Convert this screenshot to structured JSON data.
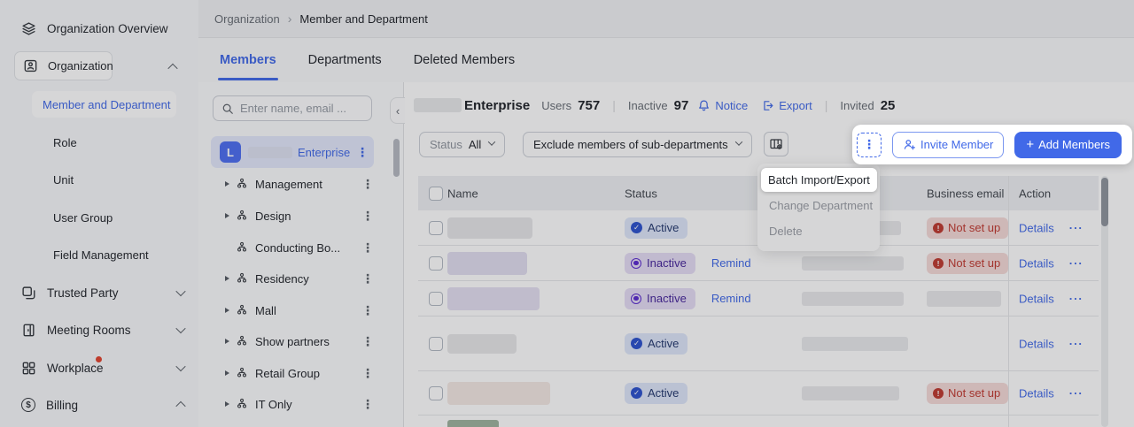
{
  "colors": {
    "accent": "#4169e8",
    "active_bg": "#dee7fa",
    "active_icon": "#2d52cf",
    "inactive_bg": "#e6ddf6",
    "inactive_icon": "#5b2bd0",
    "notset_bg": "#f6dbd8",
    "notset_fg": "#c13a31"
  },
  "icons": {
    "kebab": "⋮",
    "ellipsis": "···",
    "collapse": "‹",
    "crumb_sep": "›",
    "check": "✓",
    "exclaim": "!",
    "plus": "+",
    "dollar": "$"
  },
  "sidebar": {
    "items": [
      {
        "label": "Organization Overview"
      },
      {
        "label": "Organization"
      },
      {
        "label": "Member and Department"
      },
      {
        "label": "Role"
      },
      {
        "label": "Unit"
      },
      {
        "label": "User Group"
      },
      {
        "label": "Field Management"
      },
      {
        "label": "Trusted Party"
      },
      {
        "label": "Meeting Rooms"
      },
      {
        "label": "Workplace"
      },
      {
        "label": "Billing"
      }
    ]
  },
  "breadcrumb": {
    "parent": "Organization",
    "current": "Member and Department"
  },
  "tabs": [
    "Members",
    "Departments",
    "Deleted Members"
  ],
  "tree": {
    "search_placeholder": "Enter name, email ...",
    "root_letter": "L",
    "root_name": "Enterprise",
    "items": [
      "Management",
      "Design",
      "Conducting Bo...",
      "Residency",
      "Mall",
      "Show partners",
      "Retail Group",
      "IT Only"
    ]
  },
  "header": {
    "title": "Enterprise",
    "users_label": "Users",
    "users_value": "757",
    "divider": "|",
    "inactive_label": "Inactive",
    "inactive_value": "97",
    "notice_label": "Notice",
    "export_label": "Export",
    "invited_label": "Invited",
    "invited_value": "25"
  },
  "toolbar": {
    "status_label": "Status",
    "status_value": "All",
    "scope_value": "Exclude members of sub-departments",
    "invite_label": "Invite Member",
    "add_label": "Add Members"
  },
  "menu": {
    "items": [
      {
        "label": "Batch Import/Export"
      },
      {
        "label": "Change Department"
      },
      {
        "label": "Delete"
      }
    ]
  },
  "table": {
    "headers": [
      "Name",
      "Status",
      "",
      "Business email",
      "Action"
    ],
    "remind_label": "Remind",
    "not_set_label": "Not set up",
    "details_label": "Details",
    "rows": [
      {
        "status": "Active"
      },
      {
        "status": "Inactive"
      },
      {
        "status": "Inactive"
      },
      {
        "status": "Active"
      },
      {
        "status": "Active"
      }
    ]
  }
}
